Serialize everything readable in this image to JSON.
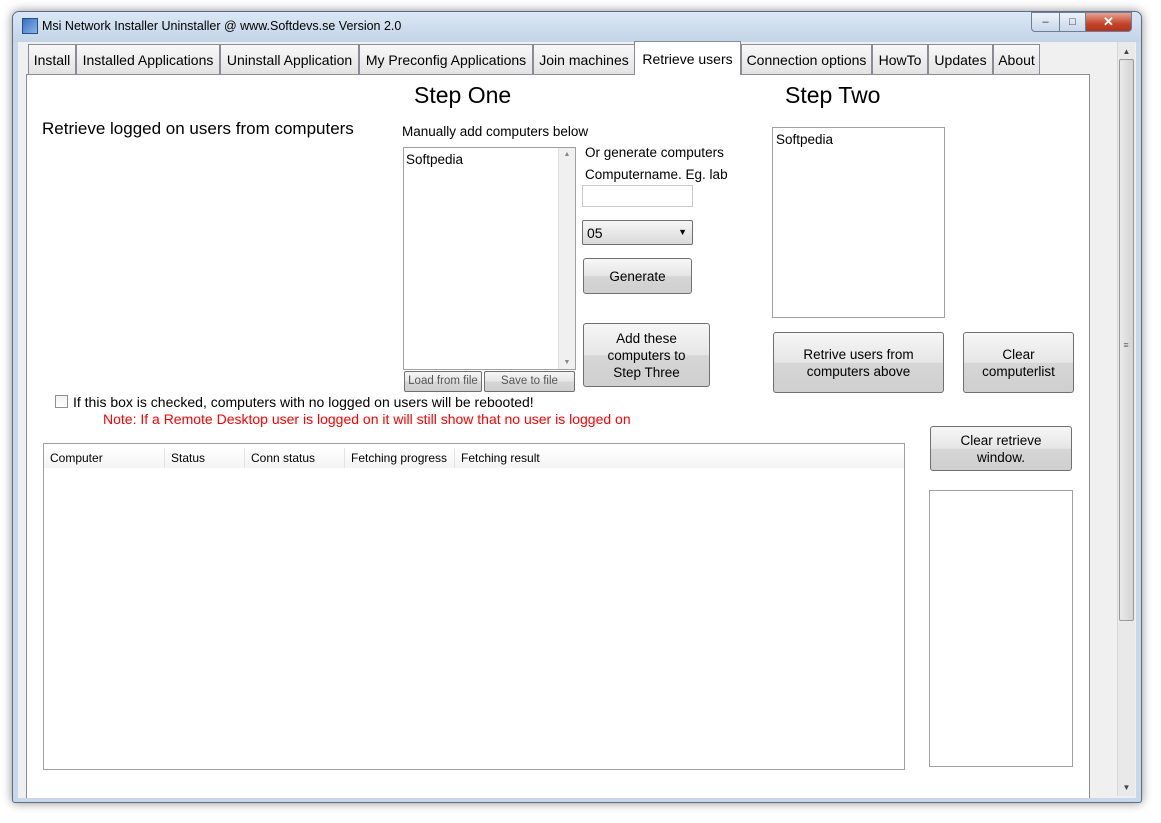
{
  "window": {
    "title": "Msi Network Installer Uninstaller @ www.Softdevs.se  Version 2.0",
    "minimize_glyph": "‒",
    "maximize_glyph": "□",
    "close_glyph": "✕"
  },
  "tabs": [
    {
      "label": "Install"
    },
    {
      "label": "Installed Applications"
    },
    {
      "label": "Uninstall Application"
    },
    {
      "label": "My Preconfig Applications"
    },
    {
      "label": "Join machines"
    },
    {
      "label": "Retrieve users",
      "active": true
    },
    {
      "label": "Connection options"
    },
    {
      "label": "HowTo"
    },
    {
      "label": "Updates"
    },
    {
      "label": "About"
    }
  ],
  "step_one": {
    "heading": "Step One",
    "description": "Retrieve logged on users from computers",
    "manual_label": "Manually add computers below",
    "manual_list_items": [
      "Softpedia"
    ],
    "load_button": "Load from file",
    "save_button": "Save to file",
    "generate_label": "Or generate computers",
    "computername_label": "Computername. Eg. lab",
    "computername_value": "",
    "count_select_value": "05",
    "generate_button": "Generate",
    "add_button": "Add these computers to Step Three"
  },
  "step_two": {
    "heading": "Step Two",
    "list_items": [
      "Softpedia"
    ],
    "retrieve_button": "Retrive users from computers above",
    "clear_button": "Clear computerlist"
  },
  "reboot": {
    "checkbox_label": "If this box is checked, computers with no logged on users will be rebooted!",
    "checked": false,
    "note": "Note: If a Remote Desktop user is logged on it will still show that no user is logged on",
    "note_color": "#ff0000"
  },
  "results": {
    "columns": [
      "Computer",
      "Status",
      "Conn status",
      "Fetching progress",
      "Fetching result"
    ],
    "rows": [],
    "clear_button": "Clear retrieve window."
  }
}
